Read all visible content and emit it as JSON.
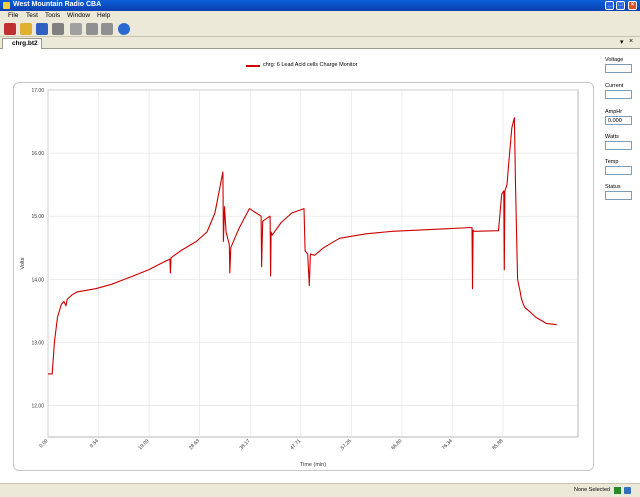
{
  "window": {
    "title": "West Mountain Radio CBA"
  },
  "menu": [
    "File",
    "Test",
    "Tools",
    "Window",
    "Help"
  ],
  "toolbar": {
    "buttons": [
      {
        "icon": "new-icon",
        "color": "#c03030"
      },
      {
        "icon": "open-folder-icon",
        "color": "#e0b030"
      },
      {
        "icon": "save-icon",
        "color": "#3060c0"
      },
      {
        "icon": "print-icon",
        "color": "#808080"
      },
      {
        "icon": "export-icon",
        "color": "#a0a0a0"
      },
      {
        "icon": "play-icon",
        "color": "#909090"
      },
      {
        "icon": "stop-icon",
        "color": "#909090"
      },
      {
        "icon": "help-icon",
        "color": "#2a6ad0"
      }
    ]
  },
  "tab": {
    "label": "chrg.bt2"
  },
  "side_panel": [
    {
      "label": "Voltage",
      "value": ""
    },
    {
      "label": "Current",
      "value": ""
    },
    {
      "label": "AmpHr",
      "value": "0.000"
    },
    {
      "label": "Watts",
      "value": ""
    },
    {
      "label": "Temp",
      "value": ""
    },
    {
      "label": "Status",
      "value": ""
    }
  ],
  "status": {
    "text": "None Selected"
  },
  "chart_data": {
    "type": "line",
    "xlabel": "Time (min)",
    "ylabel": "Volts",
    "xlim": [
      0,
      100.0
    ],
    "ylim": [
      11.5,
      17.0
    ],
    "x_ticks": [
      "0.00",
      "9.54",
      "19.09",
      "28.63",
      "38.17",
      "47.71",
      "57.26",
      "66.80",
      "76.34",
      "85.88"
    ],
    "y_ticks": [
      "12.00",
      "13.00",
      "14.00",
      "15.00",
      "16.00",
      "17.00"
    ],
    "grid": true,
    "legend_position": "top-center",
    "series": [
      {
        "name": "chrg: 6 Lead Acid cells Charge Monitor",
        "color": "#cc0000",
        "x": [
          0,
          0.8,
          1.2,
          1.8,
          2.5,
          3.0,
          3.4,
          3.6,
          4.5,
          5.5,
          7,
          9,
          12,
          16,
          19,
          22,
          23.0,
          23.1,
          23.2,
          25,
          28,
          30,
          31.5,
          33.0,
          33.1,
          33.3,
          33.6,
          34.2,
          34.3,
          34.5,
          36,
          38,
          40.2,
          40.3,
          40.5,
          41,
          41.9,
          42.0,
          42.1,
          42.3,
          44,
          46,
          48.3,
          48.5,
          49.0,
          49.3,
          49.5,
          50.3,
          52,
          55,
          60,
          65,
          70,
          75,
          80,
          80.1,
          80.2,
          80.4,
          85,
          85.6,
          86.0,
          86.1,
          86.2,
          86.6,
          86.8,
          87.5,
          88.0,
          88.2,
          88.6,
          89.1,
          89.3,
          89.7,
          90.0,
          91,
          92,
          94,
          96
        ],
        "y": [
          12.5,
          12.5,
          13.0,
          13.4,
          13.6,
          13.65,
          13.58,
          13.68,
          13.75,
          13.8,
          13.82,
          13.85,
          13.92,
          14.05,
          14.15,
          14.28,
          14.32,
          14.1,
          14.34,
          14.45,
          14.6,
          14.75,
          15.05,
          15.7,
          14.6,
          15.15,
          14.75,
          14.55,
          14.1,
          14.5,
          14.8,
          15.12,
          15.0,
          14.2,
          14.92,
          14.95,
          15.0,
          14.05,
          14.75,
          14.7,
          14.9,
          15.05,
          15.12,
          14.45,
          14.4,
          13.9,
          14.4,
          14.38,
          14.5,
          14.65,
          14.72,
          14.76,
          14.78,
          14.8,
          14.82,
          13.85,
          14.78,
          14.76,
          14.77,
          15.35,
          15.4,
          14.15,
          15.4,
          15.5,
          15.7,
          16.4,
          16.56,
          15.5,
          14.0,
          13.8,
          13.7,
          13.6,
          13.55,
          13.48,
          13.4,
          13.3,
          13.28
        ]
      }
    ]
  }
}
